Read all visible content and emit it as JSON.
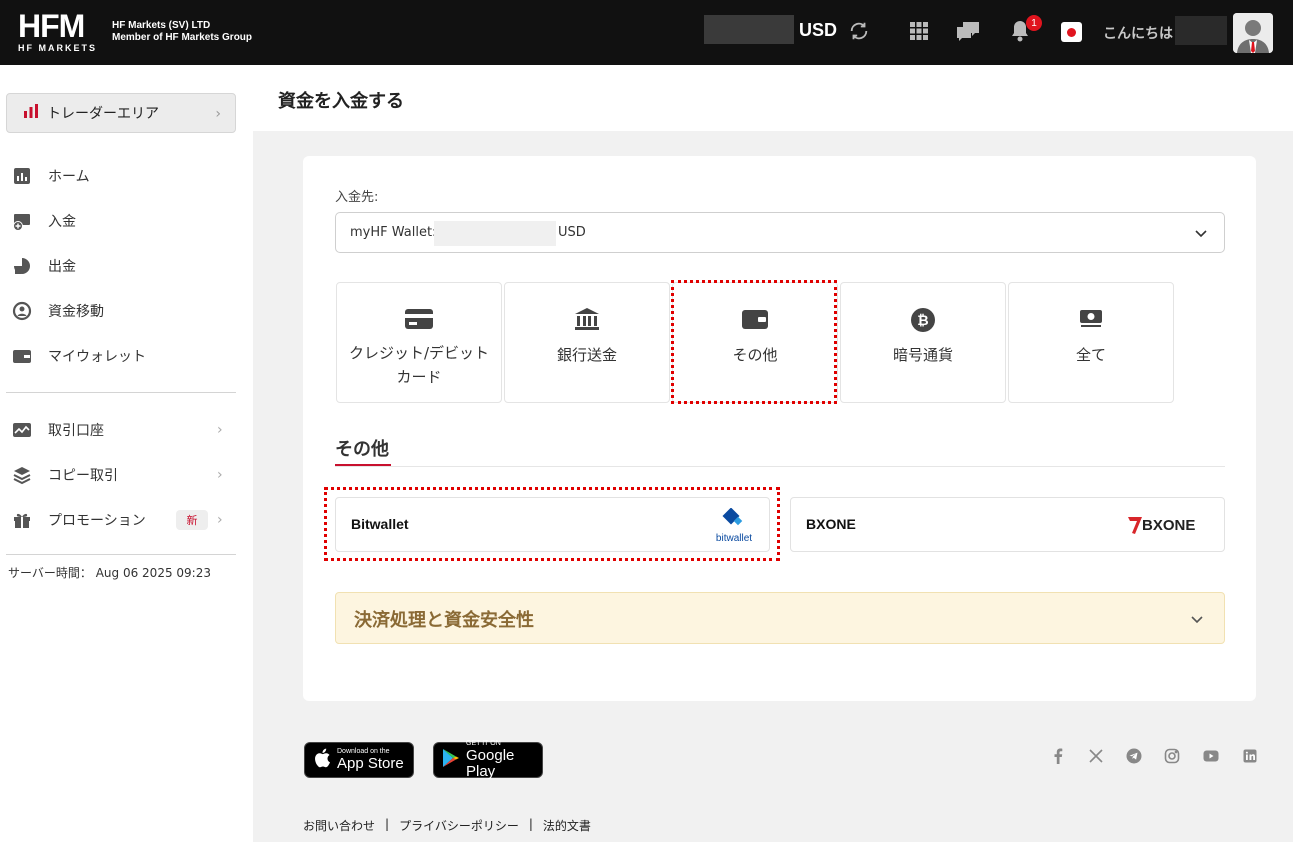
{
  "header": {
    "company_line1": "HF Markets (SV) LTD",
    "company_line2": "Member of HF Markets Group",
    "logo_text": "HFM",
    "logo_sub": "HF MARKETS",
    "currency": "USD",
    "notification_count": "1",
    "greeting": "こんにちは"
  },
  "sidebar": {
    "trader_area": "トレーダーエリア",
    "items": [
      {
        "label": "ホーム",
        "icon": "chart-icon"
      },
      {
        "label": "入金",
        "icon": "deposit-icon"
      },
      {
        "label": "出金",
        "icon": "withdraw-icon"
      },
      {
        "label": "資金移動",
        "icon": "transfer-icon"
      },
      {
        "label": "マイウォレット",
        "icon": "wallet-icon"
      }
    ],
    "items2": [
      {
        "label": "取引口座",
        "icon": "trading-account-icon"
      },
      {
        "label": "コピー取引",
        "icon": "copy-trading-icon"
      },
      {
        "label": "プロモーション",
        "icon": "gift-icon",
        "badge": "新"
      }
    ],
    "server_time_label": "サーバー時間：",
    "server_time_value": "Aug 06 2025 09:23"
  },
  "main": {
    "page_title": "資金を入金する",
    "deposit_to_label": "入金先:",
    "wallet_prefix": "myHF Wallet:",
    "wallet_currency": "USD",
    "tiles": [
      {
        "label": "クレジット/デビットカード",
        "icon": "credit-card-icon"
      },
      {
        "label": "銀行送金",
        "icon": "bank-icon"
      },
      {
        "label": "その他",
        "icon": "wallet-icon"
      },
      {
        "label": "暗号通貨",
        "icon": "bitcoin-icon"
      },
      {
        "label": "全て",
        "icon": "cash-icon"
      }
    ],
    "section_title": "その他",
    "methods": [
      {
        "name": "Bitwallet",
        "logo_text": "bitwallet"
      },
      {
        "name": "BXONE",
        "logo_text": "BXONE"
      }
    ],
    "accordion_title": "決済処理と資金安全性"
  },
  "footer": {
    "app_store_small": "Download on the",
    "app_store_big": "App Store",
    "google_small": "GET IT ON",
    "google_big": "Google Play",
    "links": [
      "お問い合わせ",
      "プライバシーポリシー",
      "法的文書"
    ],
    "link_separator": "|"
  },
  "colors": {
    "brand_red": "#e0141e",
    "header_bg": "#111111",
    "highlight_dash": "#e00000",
    "accordion_bg": "#fdf5e0"
  }
}
